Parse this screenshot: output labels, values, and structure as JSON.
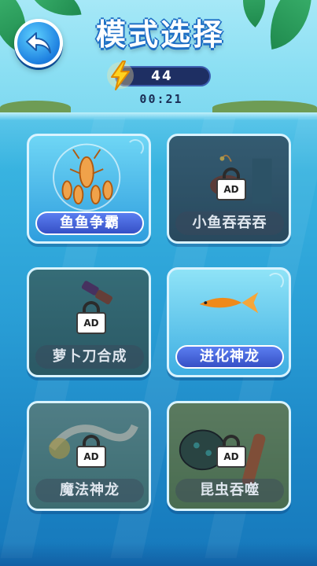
{
  "header": {
    "title": "模式选择",
    "energy": "44",
    "timer": "00:21"
  },
  "modes": [
    {
      "label": "鱼鱼争霸",
      "locked": false,
      "selected": true
    },
    {
      "label": "小鱼吞吞吞",
      "locked": true,
      "lock_text": "AD"
    },
    {
      "label": "萝卜刀合成",
      "locked": true,
      "lock_text": "AD"
    },
    {
      "label": "进化神龙",
      "locked": false,
      "selected": true
    },
    {
      "label": "魔法神龙",
      "locked": true,
      "lock_text": "AD"
    },
    {
      "label": "昆虫吞噬",
      "locked": true,
      "lock_text": "AD"
    }
  ],
  "colors": {
    "title_stroke": "#1f6fc5",
    "active_label": "#3650c6",
    "energy_bolt": "#ffd21f"
  }
}
